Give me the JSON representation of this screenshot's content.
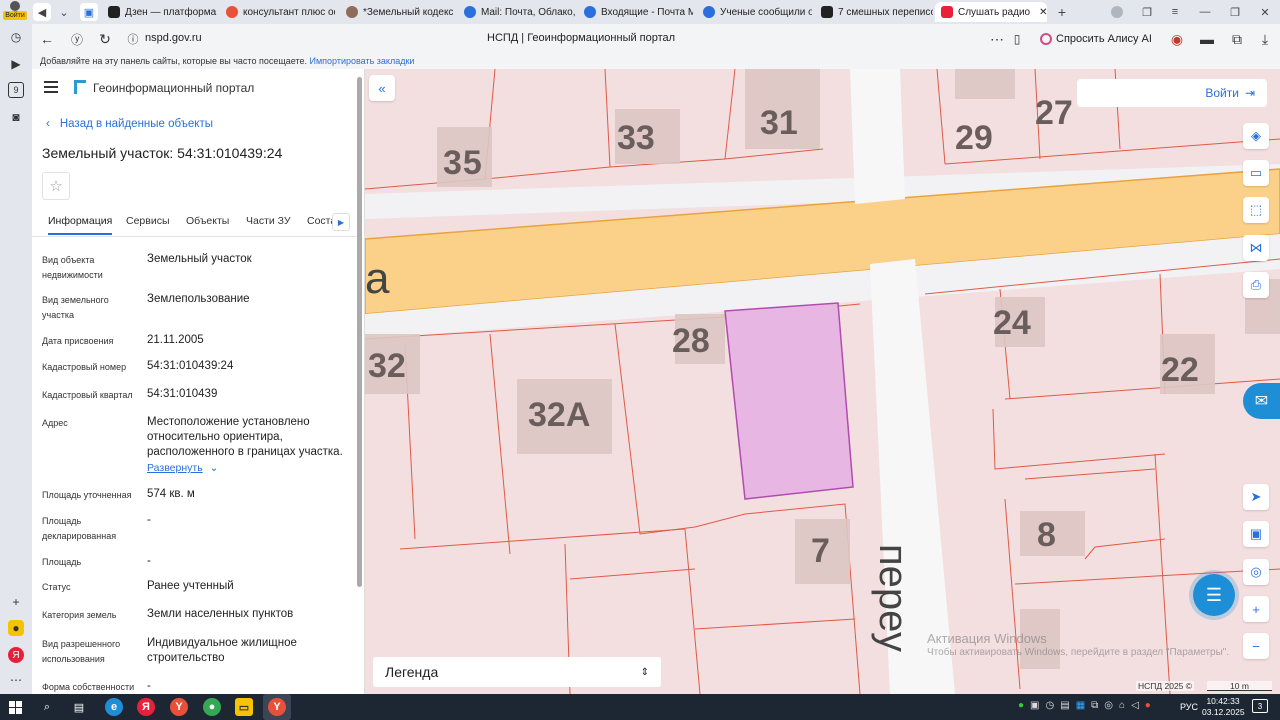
{
  "browser": {
    "tabs": [
      {
        "label": "Дзен — платформа д",
        "color": "#222"
      },
      {
        "label": "консультант плюс оф",
        "color": "#e8503a"
      },
      {
        "label": "*Земельный кодекс Р",
        "color": "#8e6b5b"
      },
      {
        "label": "Mail: Почта, Облако, К",
        "color": "#2a6fdb"
      },
      {
        "label": "Входящие - Почта Ма",
        "color": "#2a6fdb"
      },
      {
        "label": "Ученые сообщили о з",
        "color": "#2a6fdb"
      },
      {
        "label": "7 смешных переписо",
        "color": "#222"
      },
      {
        "label": "Слушать радио",
        "color": "#e8203a"
      }
    ],
    "login_label": "Войти",
    "url": "nspd.gov.ru",
    "page_title": "НСПД | Геоинформационный портал",
    "alice_label": "Спросить Алису AI",
    "bookmarks_hint": "Добавляйте на эту панель сайты, которые вы часто посещаете.",
    "bookmarks_link": "Импортировать закладки"
  },
  "panel": {
    "app_title": "Геоинформационный портал",
    "back_link": "Назад в найденные объекты",
    "object_title": "Земельный участок: 54:31:010439:24",
    "tabs": [
      "Информация",
      "Сервисы",
      "Объекты",
      "Части ЗУ",
      "Соста"
    ],
    "fields": [
      {
        "label": "Вид объекта недвижимости",
        "value": "Земельный участок"
      },
      {
        "label": "Вид земельного участка",
        "value": "Землепользование"
      },
      {
        "label": "Дата присвоения",
        "value": "21.11.2005"
      },
      {
        "label": "Кадастровый номер",
        "value": "54:31:010439:24"
      },
      {
        "label": "Кадастровый квартал",
        "value": "54:31:010439"
      },
      {
        "label": "Адрес",
        "value": "Местоположение установлено относительно ориентира, расположенного в границах участка."
      },
      {
        "label": "Площадь уточненная",
        "value": "574 кв. м"
      },
      {
        "label": "Площадь декларированная",
        "value": "-"
      },
      {
        "label": "Площадь",
        "value": "-"
      },
      {
        "label": "Статус",
        "value": "Ранее учтенный"
      },
      {
        "label": "Категория земель",
        "value": "Земли населенных пунктов"
      },
      {
        "label": "Вид разрешенного использования",
        "value": "Индивидуальное жилищное строительство"
      },
      {
        "label": "Форма собственности",
        "value": "-"
      }
    ],
    "expand_label": "Развернуть"
  },
  "map": {
    "login_label": "Войти",
    "legend_label": "Легенда",
    "house_numbers": [
      "35",
      "33",
      "31",
      "29",
      "27",
      "28",
      "32",
      "32А",
      "24",
      "22",
      "8",
      "7"
    ],
    "street_label_a": "а",
    "street_label_b": "переу",
    "scale_label": "10 m",
    "copyright": "НСПД 2025 ©",
    "watermark_title": "Активация Windows",
    "watermark_text": "Чтобы активировать Windows, перейдите в раздел \"Параметры\".",
    "parcel_fill": "#e7b6e2",
    "parcel_stroke": "#b14bb0"
  },
  "taskbar": {
    "lang": "РУС",
    "time": "10:42:33",
    "date": "03.12.2025",
    "notif_count": "3"
  }
}
